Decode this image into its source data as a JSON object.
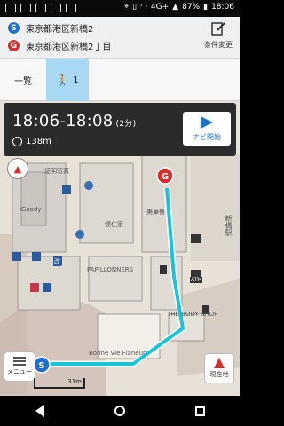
{
  "status_bar": {
    "time": "18:06",
    "battery": "87%",
    "network": "4G+"
  },
  "route": {
    "start": {
      "pin": "S",
      "label": "東京都港区新橋2"
    },
    "goal": {
      "pin": "G",
      "label": "東京都港区新橋2丁目"
    },
    "condition_change_label": "条件変更"
  },
  "tabs": [
    {
      "label": "一覧"
    },
    {
      "label": "1",
      "icon": "walker-icon",
      "active": true
    }
  ],
  "route_summary": {
    "time_range": "18:06-18:08",
    "duration": "(2分)",
    "distance": "138m",
    "navi_button_label": "ナビ開始"
  },
  "map": {
    "labels": [
      "証明写真",
      "iGoody",
      "PAPILLONNERS",
      "Bonne Vie Flaneur",
      "THE BODY SHOP",
      "ATM",
      "改",
      "美華餐",
      "健仁家",
      "新橋駅"
    ],
    "route_color": "#19c4d9",
    "scale": "31m"
  },
  "controls": {
    "menu_label": "メニュー",
    "current_location_label": "現在地"
  }
}
